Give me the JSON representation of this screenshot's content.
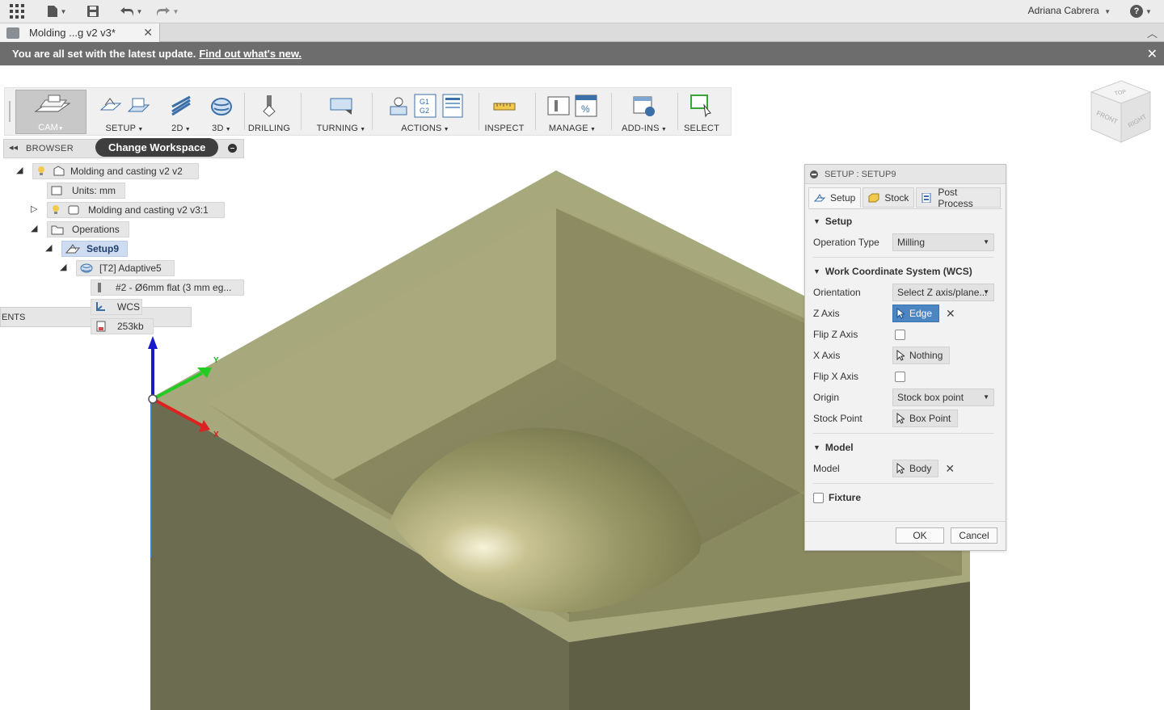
{
  "topbar": {
    "user_name": "Adriana Cabrera",
    "icons": [
      "grid-icon",
      "file-icon",
      "save-icon",
      "undo-icon",
      "redo-icon",
      "help-icon"
    ]
  },
  "document_tab": {
    "title": "Molding ...g v2 v3*"
  },
  "banner": {
    "text": "You are all set with the latest update.",
    "link": "Find out what's new."
  },
  "toolbar": {
    "workspace": "CAM",
    "groups": [
      {
        "label": "SETUP"
      },
      {
        "label": "2D"
      },
      {
        "label": "3D"
      },
      {
        "label": "DRILLING"
      },
      {
        "label": "TURNING"
      },
      {
        "label": "ACTIONS"
      },
      {
        "label": "INSPECT"
      },
      {
        "label": "MANAGE"
      },
      {
        "label": "ADD-INS"
      },
      {
        "label": "SELECT"
      }
    ],
    "g1g2_text": "G1\nG2"
  },
  "browser": {
    "title": "BROWSER",
    "tooltip": "Change Workspace",
    "ents_label": "ENTS",
    "nodes": {
      "root": "Molding and casting v2 v2",
      "units": "Units: mm",
      "component": "Molding and casting v2 v3:1",
      "operations": "Operations",
      "setup": "Setup9",
      "adaptive": "[T2] Adaptive5",
      "tool": "#2 - Ø6mm flat (3 mm eg...",
      "wcs": "WCS",
      "size": "253kb"
    }
  },
  "axes": {
    "y": "Y",
    "x": "X"
  },
  "dialog": {
    "title": "SETUP : SETUP9",
    "tabs": {
      "setup": "Setup",
      "stock": "Stock",
      "post": "Post Process"
    },
    "sections": {
      "setup": "Setup",
      "wcs": "Work Coordinate System (WCS)",
      "model": "Model",
      "fixture": "Fixture"
    },
    "fields": {
      "operation_type_label": "Operation Type",
      "operation_type_value": "Milling",
      "orientation_label": "Orientation",
      "orientation_value": "Select Z axis/plane...",
      "z_axis_label": "Z Axis",
      "z_axis_value": "Edge",
      "flip_z_label": "Flip Z Axis",
      "x_axis_label": "X Axis",
      "x_axis_value": "Nothing",
      "flip_x_label": "Flip X Axis",
      "origin_label": "Origin",
      "origin_value": "Stock box point",
      "stock_point_label": "Stock Point",
      "stock_point_value": "Box Point",
      "model_label": "Model",
      "model_value": "Body"
    },
    "ok": "OK",
    "cancel": "Cancel",
    "accent": "#4b86c3"
  },
  "viewcube": {
    "top": "TOP",
    "front": "FRONT",
    "right": "RIGHT"
  }
}
